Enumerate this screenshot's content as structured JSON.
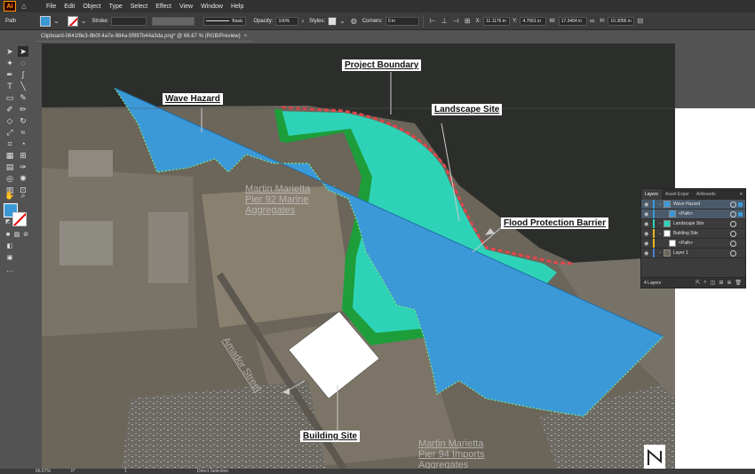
{
  "app": {
    "logo": "Ai",
    "home_icon": "home-icon"
  },
  "menu": [
    "File",
    "Edit",
    "Object",
    "Type",
    "Select",
    "Effect",
    "View",
    "Window",
    "Help"
  ],
  "control_bar": {
    "object_type": "Path",
    "stroke_label": "Stroke:",
    "brush_label": "Basic",
    "opacity_label": "Opacity:",
    "opacity_value": "100%",
    "styles_label": "Styles:",
    "corners_label": "Corners:",
    "corners_value": "0 in",
    "x_label": "X:",
    "x_value": "11.1176 in",
    "y_label": "Y:",
    "y_value": "4.7561 in",
    "w_label": "W:",
    "w_value": "17.3464 in",
    "h_label": "H:",
    "h_value": "10.3056 in",
    "fill_color": "#3b99d8"
  },
  "document": {
    "tab_title": "Clipboard-0641f8e3-9b0f-4a7e-984a-5f997b44a3da.png* @ 66.67 % (RGB/Preview)",
    "close": "×"
  },
  "map": {
    "labels": {
      "project_boundary": "Project Boundary",
      "wave_hazard": "Wave Hazard",
      "landscape_site": "Landscape Site",
      "flood_barrier": "Flood Protection Barrier",
      "building_site": "Building Site"
    },
    "ghost_text": {
      "martin_92_l1": "Martin Marietta",
      "martin_92_l2": "Pier 92 Marine",
      "martin_92_l3": "Aggregates",
      "amador": "Amador Street",
      "martin_94_l1": "Martin Marietta",
      "martin_94_l2": "Pier 94 Imports",
      "martin_94_l3": "Aggregates"
    },
    "colors": {
      "wave_hazard": "#3b99d8",
      "landscape": "#2ed3b7",
      "barrier": "#1d9e3a",
      "boundary": "#e0474c"
    }
  },
  "layers_panel": {
    "tabs": [
      "Layers",
      "Asset Expor",
      "Artboards"
    ],
    "menu_icon": "»",
    "rows": [
      {
        "name": "Wave Hazard",
        "color": "#3b99d8",
        "expanded": true,
        "selected": true
      },
      {
        "name": "<Path>",
        "color": "#3b99d8",
        "expanded": false,
        "selected": true
      },
      {
        "name": "Landscape Site",
        "color": "#2ed3b7",
        "expanded": false,
        "selected": false
      },
      {
        "name": "Building Site",
        "color": "#e8b923",
        "expanded": true,
        "selected": false
      },
      {
        "name": "<Path>",
        "color": "#e8b923",
        "expanded": false,
        "selected": false
      },
      {
        "name": "Layer 1",
        "color": "#4a7fd6",
        "expanded": false,
        "selected": false
      }
    ],
    "count": "4 Layers"
  },
  "status_bar": {
    "zoom": "66.67%",
    "rotation": "0°",
    "page": "1",
    "tool": "Direct Selection"
  }
}
